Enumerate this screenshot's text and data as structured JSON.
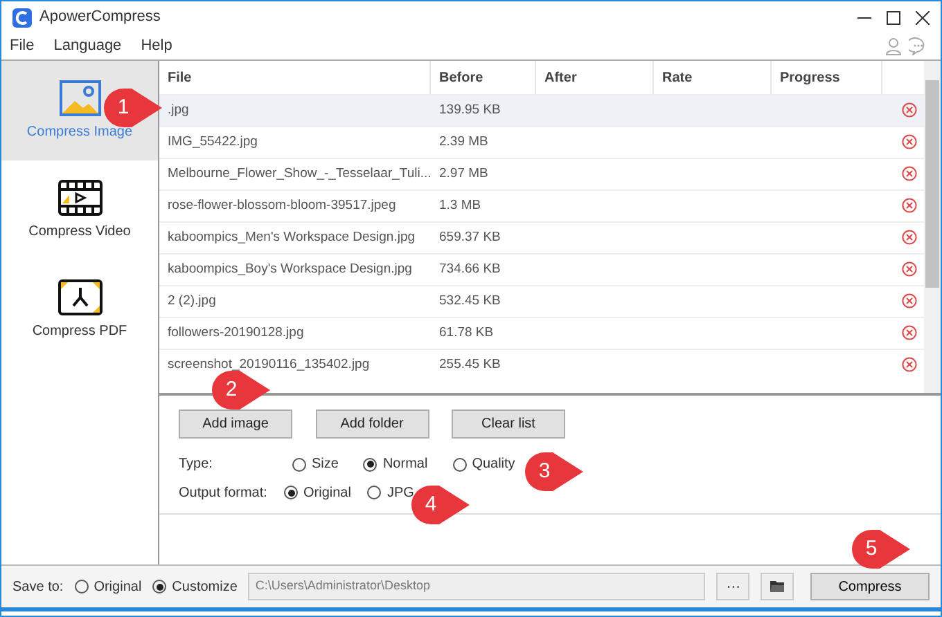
{
  "window": {
    "title": "ApowerCompress"
  },
  "menu": [
    "File",
    "Language",
    "Help"
  ],
  "sidebar": {
    "items": [
      {
        "kind": "image",
        "label": "Compress Image",
        "selected": true
      },
      {
        "kind": "video",
        "label": "Compress Video",
        "selected": false
      },
      {
        "kind": "pdf",
        "label": "Compress PDF",
        "selected": false
      }
    ]
  },
  "table": {
    "columns": [
      "File",
      "Before",
      "After",
      "Rate",
      "Progress"
    ],
    "rows": [
      {
        "file": ".jpg",
        "before": "139.95 KB",
        "selected": true
      },
      {
        "file": "IMG_55422.jpg",
        "before": "2.39 MB",
        "selected": false
      },
      {
        "file": "Melbourne_Flower_Show_-_Tesselaar_Tuli...",
        "before": "2.97 MB",
        "selected": false
      },
      {
        "file": "rose-flower-blossom-bloom-39517.jpeg",
        "before": "1.3 MB",
        "selected": false
      },
      {
        "file": "kaboompics_Men's Workspace Design.jpg",
        "before": "659.37 KB",
        "selected": false
      },
      {
        "file": "kaboompics_Boy's Workspace Design.jpg",
        "before": "734.66 KB",
        "selected": false
      },
      {
        "file": "2 (2).jpg",
        "before": "532.45 KB",
        "selected": false
      },
      {
        "file": "followers-20190128.jpg",
        "before": "61.78 KB",
        "selected": false
      },
      {
        "file": "screenshot_20190116_135402.jpg",
        "before": "255.45 KB",
        "selected": false
      }
    ]
  },
  "buttons": [
    "Add image",
    "Add folder",
    "Clear list"
  ],
  "type": {
    "label": "Type:",
    "options": [
      {
        "label": "Size",
        "selected": false
      },
      {
        "label": "Normal",
        "selected": true
      },
      {
        "label": "Quality",
        "selected": false
      }
    ]
  },
  "output_format": {
    "label": "Output format:",
    "options": [
      {
        "label": "Original",
        "selected": true
      },
      {
        "label": "JPG",
        "selected": false
      }
    ]
  },
  "save_to": {
    "label": "Save to:",
    "options": [
      {
        "label": "Original",
        "selected": false
      },
      {
        "label": "Customize",
        "selected": true
      }
    ],
    "path": "C:\\Users\\Administrator\\Desktop",
    "browse": "···"
  },
  "compress_button": "Compress",
  "callouts": [
    "1",
    "2",
    "3",
    "4",
    "5"
  ]
}
